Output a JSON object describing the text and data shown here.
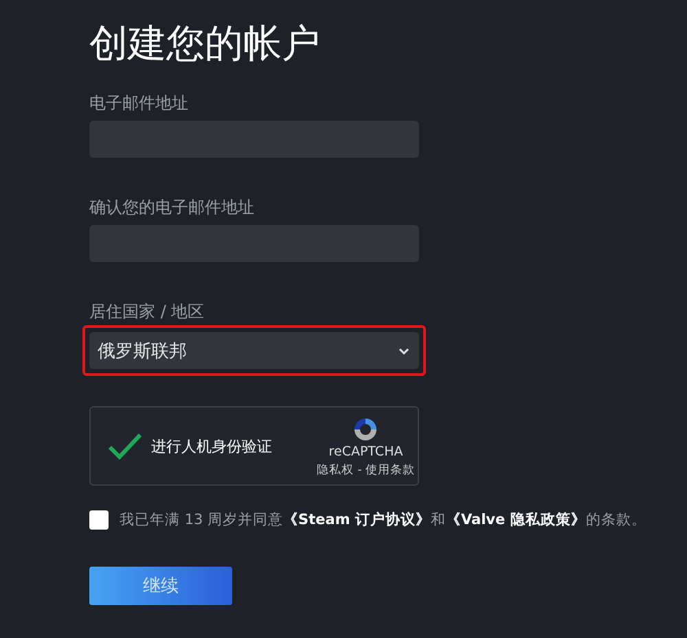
{
  "title": "创建您的帐户",
  "fields": [
    {
      "kind": "text",
      "label": "电子邮件地址"
    },
    {
      "kind": "text",
      "label": "确认您的电子邮件地址"
    },
    {
      "kind": "select",
      "label": "居住国家 / 地区",
      "value": "俄罗斯联邦",
      "highlighted": true
    }
  ],
  "captcha": {
    "checked": true,
    "label": "进行人机身份验证",
    "brand": "reCAPTCHA",
    "links": "隐私权 - 使用条款"
  },
  "agreement": {
    "checked": false,
    "text": "我已年满 13 周岁并同意**《Steam 订户协议》**和**《Valve 隐私政策》**的条款。"
  },
  "button": "继续"
}
